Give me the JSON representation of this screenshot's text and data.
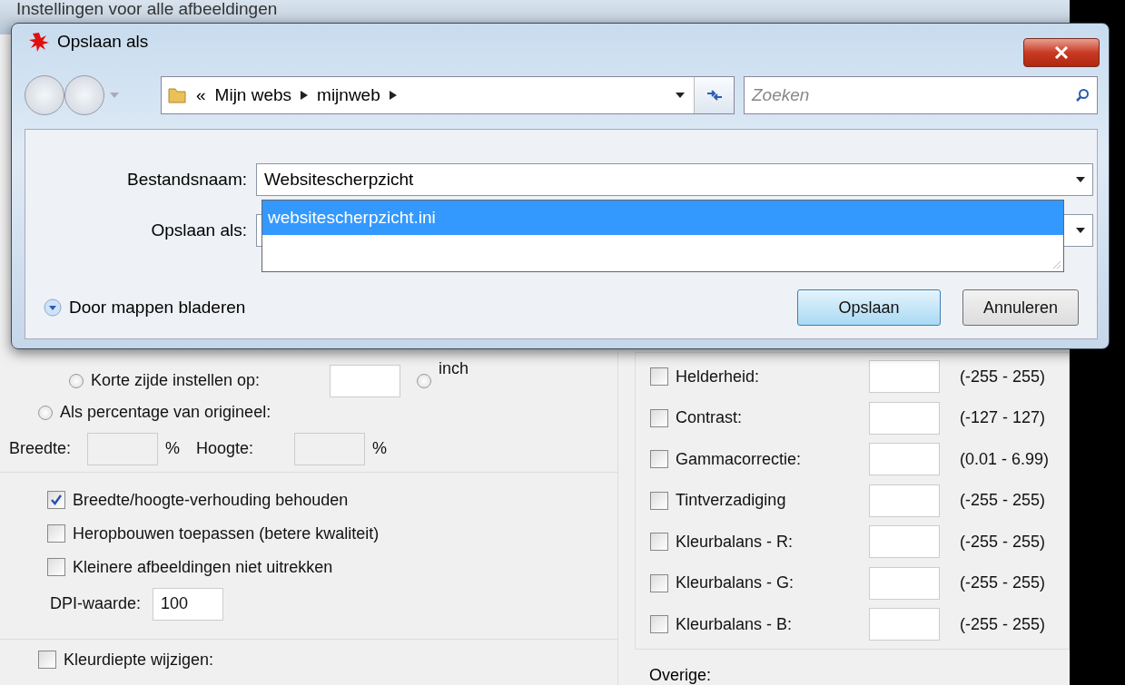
{
  "background_window": {
    "title": "Instellingen voor alle afbeeldingen"
  },
  "resize": {
    "short_side": {
      "label": "Korte zijde instellen op:",
      "selected": false
    },
    "unit_inch": {
      "label": "inch",
      "selected": false
    },
    "percentage": {
      "label": "Als percentage van origineel:",
      "selected": false
    },
    "width_label": "Breedte:",
    "width_unit": "%",
    "height_label": "Hoogte:",
    "height_unit": "%"
  },
  "options": [
    {
      "label": "Breedte/hoogte-verhouding behouden",
      "checked": true
    },
    {
      "label": "Heropbouwen toepassen (betere kwaliteit)",
      "checked": false
    },
    {
      "label": "Kleinere afbeeldingen niet uitrekken",
      "checked": false
    }
  ],
  "dpi": {
    "label": "DPI-waarde:",
    "value": "100"
  },
  "color_depth": {
    "label": "Kleurdiepte wijzigen:",
    "checked": false
  },
  "adjustments": [
    {
      "label": "Helderheid:",
      "checked": false,
      "range": "(-255 - 255)"
    },
    {
      "label": "Contrast:",
      "checked": false,
      "range": "(-127 - 127)"
    },
    {
      "label": "Gammacorrectie:",
      "checked": false,
      "range": "(0.01 - 6.99)"
    },
    {
      "label": "Tintverzadiging",
      "checked": false,
      "range": "(-255 - 255)"
    },
    {
      "label": "Kleurbalans - R:",
      "checked": false,
      "range": "(-255 - 255)"
    },
    {
      "label": "Kleurbalans - G:",
      "checked": false,
      "range": "(-255 - 255)"
    },
    {
      "label": "Kleurbalans - B:",
      "checked": false,
      "range": "(-255 - 255)"
    }
  ],
  "other": {
    "label": "Overige:"
  },
  "dialog": {
    "title": "Opslaan als",
    "breadcrumb_prefix": "«",
    "path": [
      "Mijn webs",
      "mijnweb"
    ],
    "search": {
      "placeholder": "Zoeken"
    },
    "filename_label": "Bestandsnaam:",
    "filename": "Websitescherpzicht",
    "filetype_label": "Opslaan als:",
    "suggestions": [
      {
        "text": "websitescherpzicht.ini",
        "selected": true
      }
    ],
    "browse": "Door mappen bladeren",
    "buttons": [
      {
        "label": "Opslaan",
        "kind": "default"
      },
      {
        "label": "Annuleren",
        "kind": "normal"
      }
    ]
  }
}
